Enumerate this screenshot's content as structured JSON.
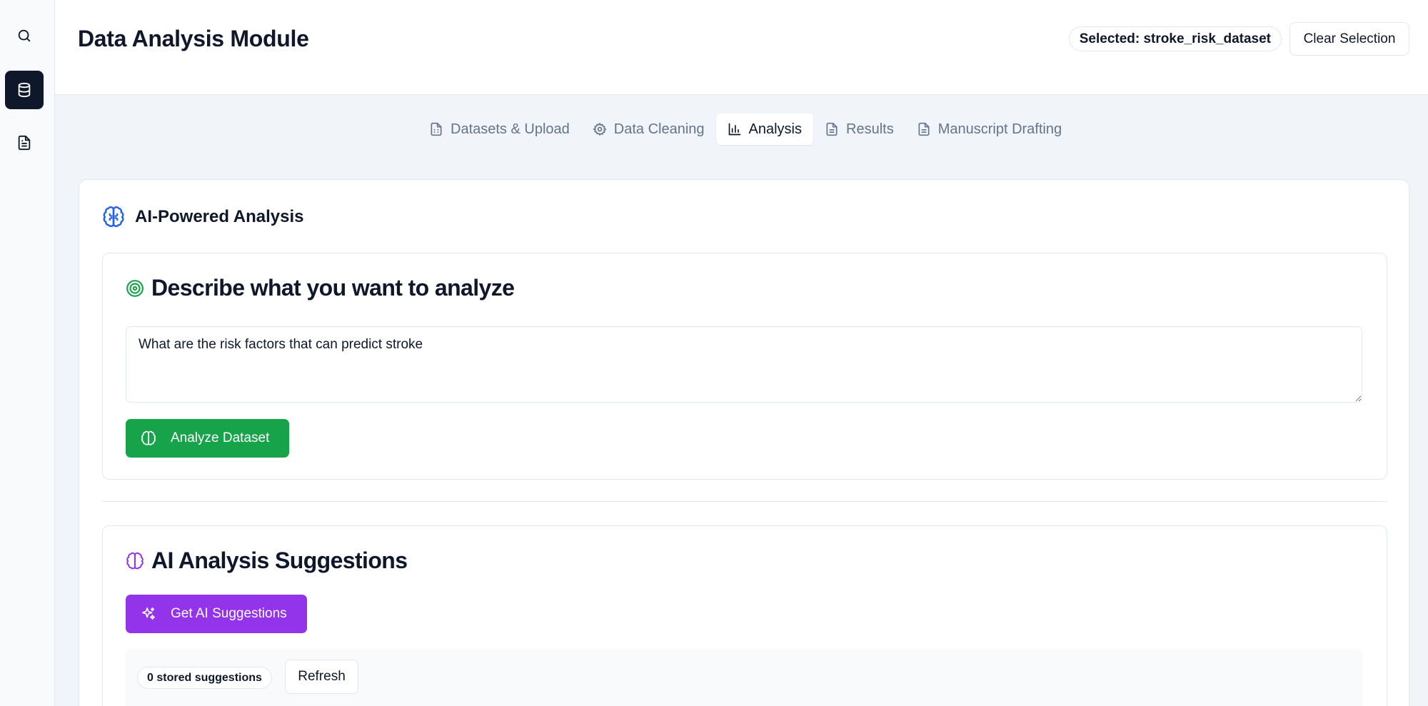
{
  "sidebar": {
    "items": [
      {
        "icon": "search-icon"
      },
      {
        "icon": "database-icon",
        "active": true
      },
      {
        "icon": "file-text-icon"
      }
    ]
  },
  "header": {
    "title": "Data Analysis Module",
    "selected_badge": "Selected: stroke_risk_dataset",
    "clear_button": "Clear Selection"
  },
  "tabs": [
    {
      "label": "Datasets & Upload",
      "icon": "file-spreadsheet-icon"
    },
    {
      "label": "Data Cleaning",
      "icon": "gear-icon"
    },
    {
      "label": "Analysis",
      "icon": "bar-chart-icon",
      "active": true
    },
    {
      "label": "Results",
      "icon": "file-text-icon"
    },
    {
      "label": "Manuscript Drafting",
      "icon": "file-text-icon"
    }
  ],
  "main": {
    "title": "AI-Powered Analysis",
    "describe": {
      "heading": "Describe what you want to analyze",
      "textarea_value": "What are the risk factors that can predict stroke",
      "analyze_button": "Analyze Dataset"
    },
    "suggestions": {
      "heading": "AI Analysis Suggestions",
      "get_button": "Get AI Suggestions",
      "stored_count": "0 stored suggestions",
      "refresh_button": "Refresh"
    }
  },
  "colors": {
    "primary_dark": "#0f172a",
    "green": "#16a34a",
    "purple": "#9333ea",
    "blue": "#2563eb"
  }
}
